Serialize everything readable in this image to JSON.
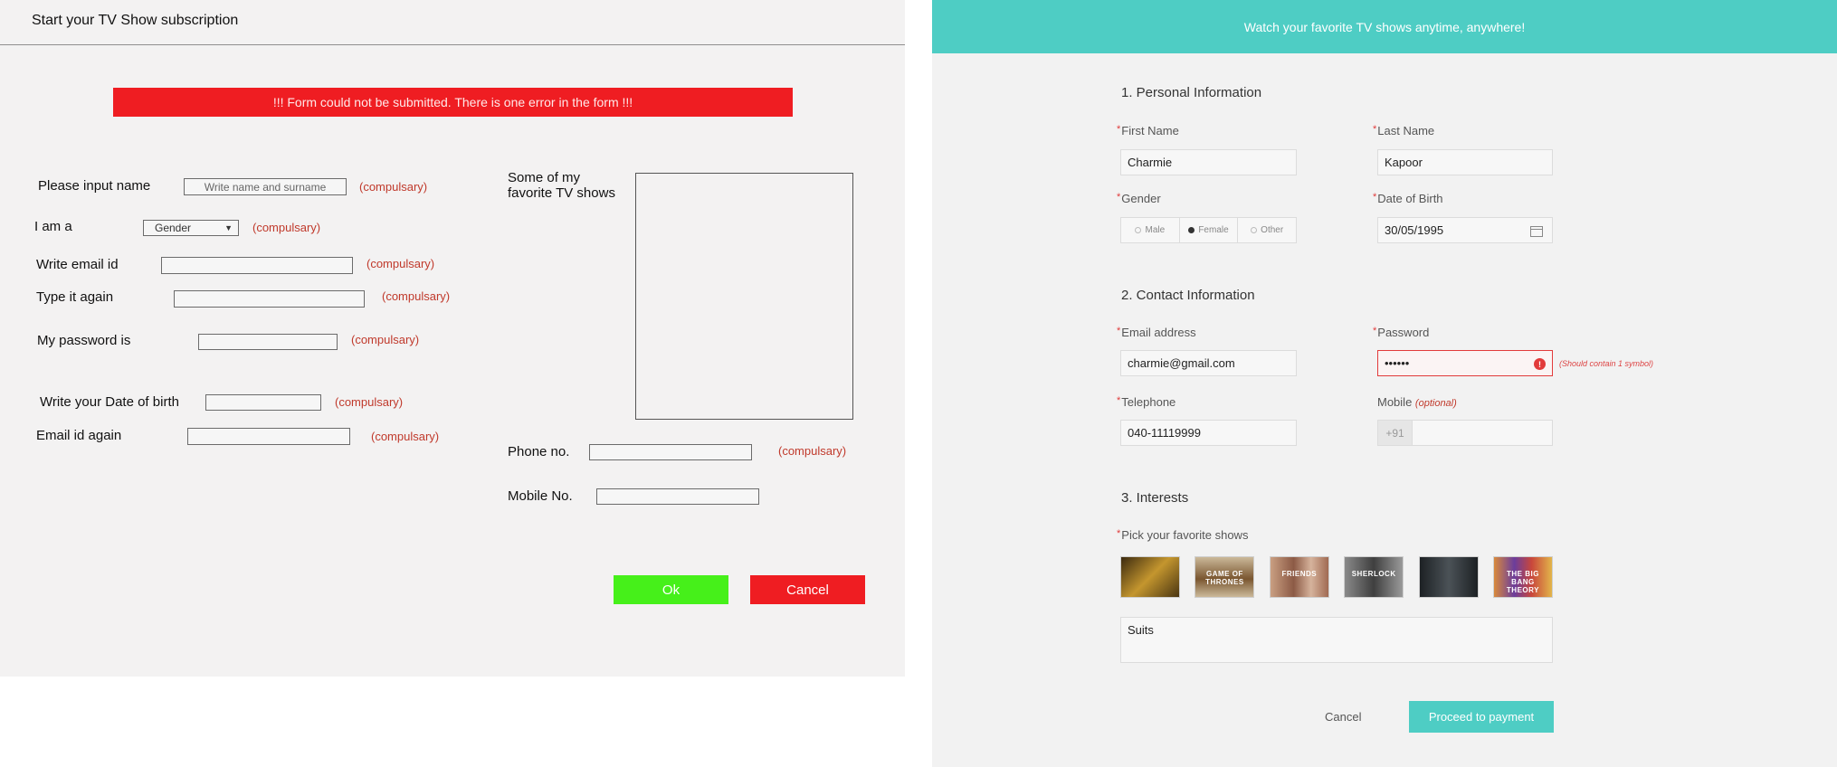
{
  "left": {
    "title": "Start your TV Show subscription",
    "error_banner": "!!! Form could not be submitted. There is one error in the form !!!",
    "fields": {
      "name_label": "Please input name",
      "name_placeholder": "Write name and surname",
      "gender_label": "I am a",
      "gender_select": "Gender",
      "email_label": "Write email id",
      "email_again_label": "Type it again",
      "password_label": "My password is",
      "dob_label": "Write your Date of birth",
      "email_id_again_label": "Email id again",
      "shows_label_line1": "Some of my",
      "shows_label_line2": "favorite TV shows",
      "phone_label": "Phone no.",
      "mobile_label": "Mobile No."
    },
    "required_text": "(compulsary)",
    "ok_label": "Ok",
    "cancel_label": "Cancel",
    "colors": {
      "ok": "#46f01a",
      "cancel": "#ef1d22",
      "error": "#ef1d22"
    }
  },
  "right": {
    "header": "Watch your favorite TV shows anytime, anywhere!",
    "section1": "1. Personal Information",
    "first_name_label": "First Name",
    "first_name_value": "Charmie",
    "last_name_label": "Last Name",
    "last_name_value": "Kapoor",
    "gender_label": "Gender",
    "gender_options": [
      "Male",
      "Female",
      "Other"
    ],
    "gender_selected": "Female",
    "dob_label": "Date of Birth",
    "dob_value": "30/05/1995",
    "section2": "2. Contact Information",
    "email_label": "Email address",
    "email_value": "charmie@gmail.com",
    "password_label": "Password",
    "password_value": "••••••",
    "password_hint": "(Should contain 1 symbol)",
    "telephone_label": "Telephone",
    "telephone_value": "040-11119999",
    "mobile_label": "Mobile",
    "mobile_optional": "(optional)",
    "mobile_prefix": "+91",
    "section3": "3. Interests",
    "shows_label": "Pick your favorite shows",
    "shows_value": "Suits",
    "cancel_label": "Cancel",
    "proceed_label": "Proceed to payment",
    "accent": "#4ecdc4",
    "thumbs": [
      {
        "name": "show-thumb-1",
        "color": "#7a5a1c",
        "text": ""
      },
      {
        "name": "show-thumb-2",
        "color": "#8b6a3a",
        "text": "GAME OF THRONES"
      },
      {
        "name": "show-thumb-3",
        "color": "#b88a6a",
        "text": "FRIENDS"
      },
      {
        "name": "show-thumb-4",
        "color": "#6d6d6d",
        "text": "SHERLOCK"
      },
      {
        "name": "show-thumb-5",
        "color": "#2e3336",
        "text": ""
      },
      {
        "name": "show-thumb-6",
        "color": "#c4723a",
        "text": "THE BIG BANG THEORY"
      }
    ]
  }
}
